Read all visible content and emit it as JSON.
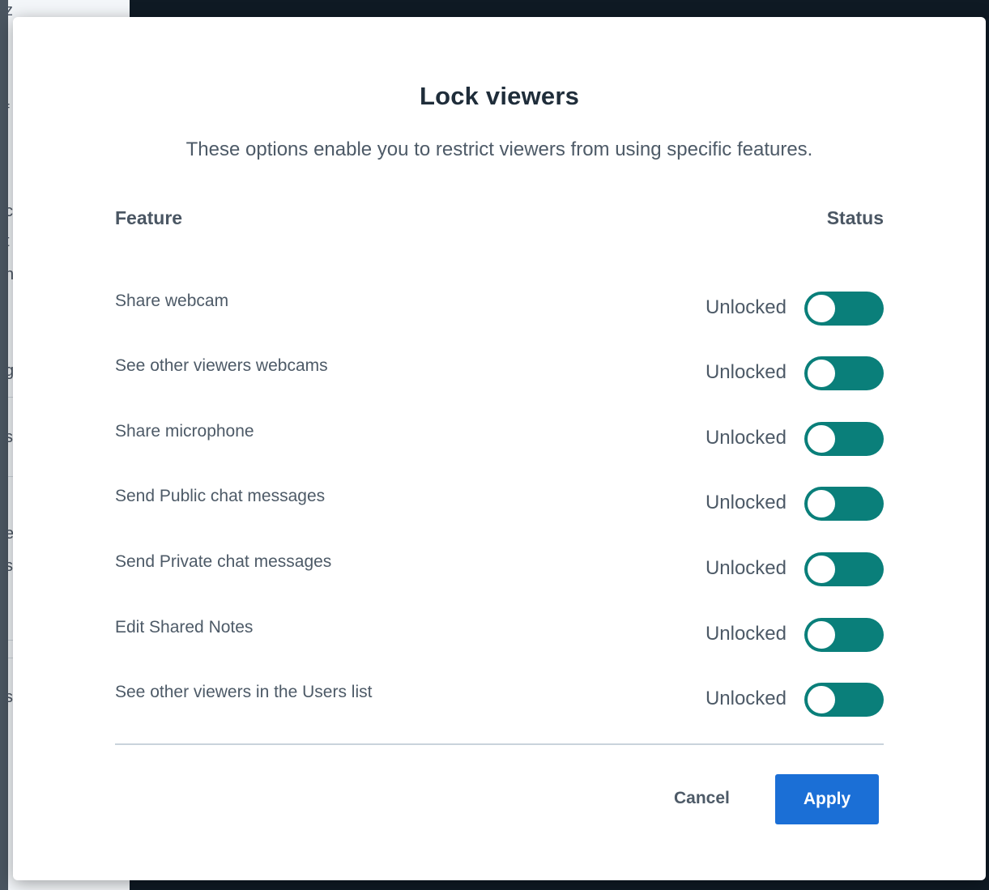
{
  "background": {
    "glyphs": [
      "z",
      "f",
      "c",
      "t",
      "n",
      "g",
      "s",
      "e",
      "s",
      "s",
      "i"
    ]
  },
  "modal": {
    "title": "Lock viewers",
    "description": "These options enable you to restrict viewers from using specific features.",
    "headers": {
      "feature": "Feature",
      "status": "Status"
    },
    "features": [
      {
        "label": "Share webcam",
        "status": "Unlocked",
        "locked": false
      },
      {
        "label": "See other viewers webcams",
        "status": "Unlocked",
        "locked": false
      },
      {
        "label": "Share microphone",
        "status": "Unlocked",
        "locked": false
      },
      {
        "label": "Send Public chat messages",
        "status": "Unlocked",
        "locked": false
      },
      {
        "label": "Send Private chat messages",
        "status": "Unlocked",
        "locked": false
      },
      {
        "label": "Edit Shared Notes",
        "status": "Unlocked",
        "locked": false
      },
      {
        "label": "See other viewers in the Users list",
        "status": "Unlocked",
        "locked": false
      }
    ],
    "actions": {
      "cancel_label": "Cancel",
      "apply_label": "Apply"
    }
  },
  "colors": {
    "toggle": "#0a7f7a",
    "apply": "#1b6fd6"
  }
}
